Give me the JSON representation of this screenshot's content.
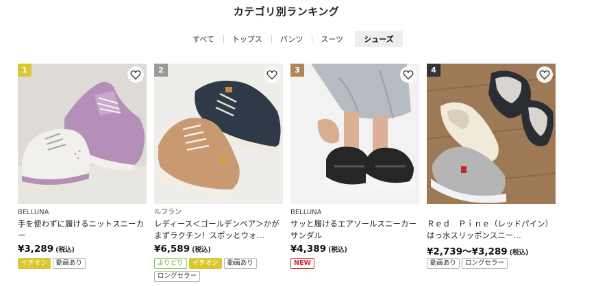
{
  "header": {
    "title": "カテゴリ別ランキング"
  },
  "tabs": [
    {
      "label": "すべて",
      "active": false
    },
    {
      "label": "トップス",
      "active": false
    },
    {
      "label": "パンツ",
      "active": false
    },
    {
      "label": "スーツ",
      "active": false
    },
    {
      "label": "シューズ",
      "active": true
    }
  ],
  "colors": {
    "rank1": "#d9c832",
    "rank2": "#9a9a9a",
    "rank3": "#b3845a",
    "rank4": "#333333",
    "pick_badge": "#d9c832",
    "yoridori_badge": "#6fa63a",
    "new_badge": "#d4242f"
  },
  "icons": {
    "favorite": "heart-outline-icon"
  },
  "products": [
    {
      "rank": "1",
      "brand": "BELLUNA",
      "name": "手を使わずに履けるニットスニーカー",
      "price": "¥3,289",
      "tax": "(税込)",
      "badges": [
        {
          "label": "イチオシ",
          "type": "pick"
        },
        {
          "label": "動画あり",
          "type": "default"
        }
      ]
    },
    {
      "rank": "2",
      "brand": "ルフラン",
      "name": "レディース＜ゴールデンベア＞かがまずラクチン！スポッとウォ…",
      "price": "¥6,589",
      "tax": "(税込)",
      "badges": [
        {
          "label": "よりどり",
          "type": "yori"
        },
        {
          "label": "イチオシ",
          "type": "pick"
        },
        {
          "label": "動画あり",
          "type": "default"
        },
        {
          "label": "ロングセラー",
          "type": "default"
        }
      ]
    },
    {
      "rank": "3",
      "brand": "BELLUNA",
      "name": "サッと履けるエアソールスニーカーサンダル",
      "price": "¥4,389",
      "tax": "(税込)",
      "badges": [
        {
          "label": "NEW",
          "type": "new"
        }
      ]
    },
    {
      "rank": "4",
      "brand": "",
      "name": "Ｒｅｄ　Ｐｉｎｅ（レッドパイン）　はっ水スリッポンスニー…",
      "price": "¥2,739～¥3,289",
      "tax": "(税込)",
      "badges": [
        {
          "label": "動画あり",
          "type": "default"
        },
        {
          "label": "ロングセラー",
          "type": "default"
        }
      ]
    }
  ]
}
